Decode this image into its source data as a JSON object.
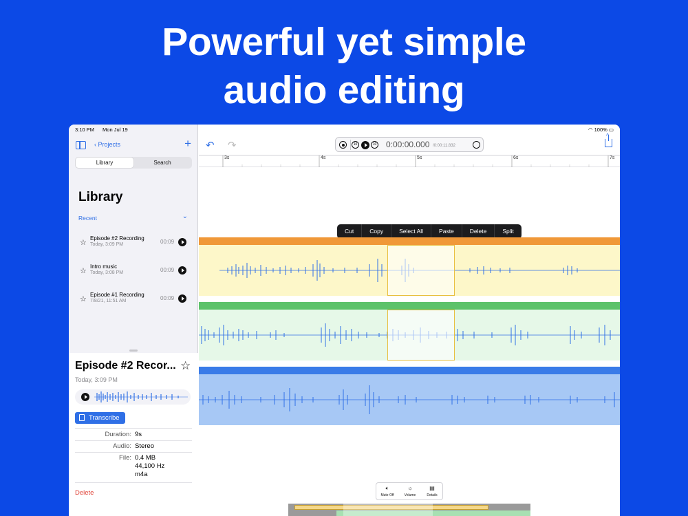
{
  "headline": {
    "line1": "Powerful yet simple",
    "line2": "audio editing"
  },
  "status": {
    "time": "3:10 PM",
    "date": "Mon Jul 19",
    "battery": "100%"
  },
  "sidebar": {
    "back_label": "Projects",
    "add_icon": "+",
    "tabs": [
      {
        "label": "Library"
      },
      {
        "label": "Search"
      }
    ],
    "title": "Library",
    "section_label": "Recent",
    "items": [
      {
        "name": "Episode #2 Recording",
        "date": "Today, 3:09 PM",
        "duration": "00:09"
      },
      {
        "name": "Intro music",
        "date": "Today, 3:08 PM",
        "duration": "00:09"
      },
      {
        "name": "Episode #1 Recording",
        "date": "7/8/21, 11:51 AM",
        "duration": "00:09"
      }
    ]
  },
  "detail": {
    "title": "Episode #2 Recor...",
    "date": "Today, 3:09 PM",
    "transcribe_label": "Transcribe",
    "duration_label": "Duration:",
    "duration_value": "9s",
    "audio_label": "Audio:",
    "audio_value": "Stereo",
    "file_label": "File:",
    "file_size": "0.4 MB",
    "file_rate": "44,100 Hz",
    "file_format": "m4a",
    "delete_label": "Delete"
  },
  "transport": {
    "time": "0:00:00.000",
    "total_prefix": "/0:00:",
    "total_value": "11.832",
    "skip_back": "10",
    "skip_fwd": "10"
  },
  "ruler": {
    "ticks": [
      "3s",
      "4s",
      "5s",
      "6s",
      "7s"
    ]
  },
  "edit_menu": {
    "cut": "Cut",
    "copy": "Copy",
    "select_all": "Select All",
    "paste": "Paste",
    "delete": "Delete",
    "split": "Split"
  },
  "bottom_toolbar": {
    "mute": "Mute Off",
    "volume": "Volume",
    "details": "Details"
  },
  "colors": {
    "background": "#0c49e6",
    "accent": "#2f6fe6",
    "track1": "#f09838",
    "track2": "#5cc26a",
    "track3": "#3a7be8",
    "delete": "#e0453a"
  },
  "icons": {
    "sidebar_toggle": "sidebar-icon",
    "undo": "undo-icon",
    "redo": "redo-icon",
    "share": "share-icon",
    "star": "star-icon",
    "play": "play-icon"
  }
}
